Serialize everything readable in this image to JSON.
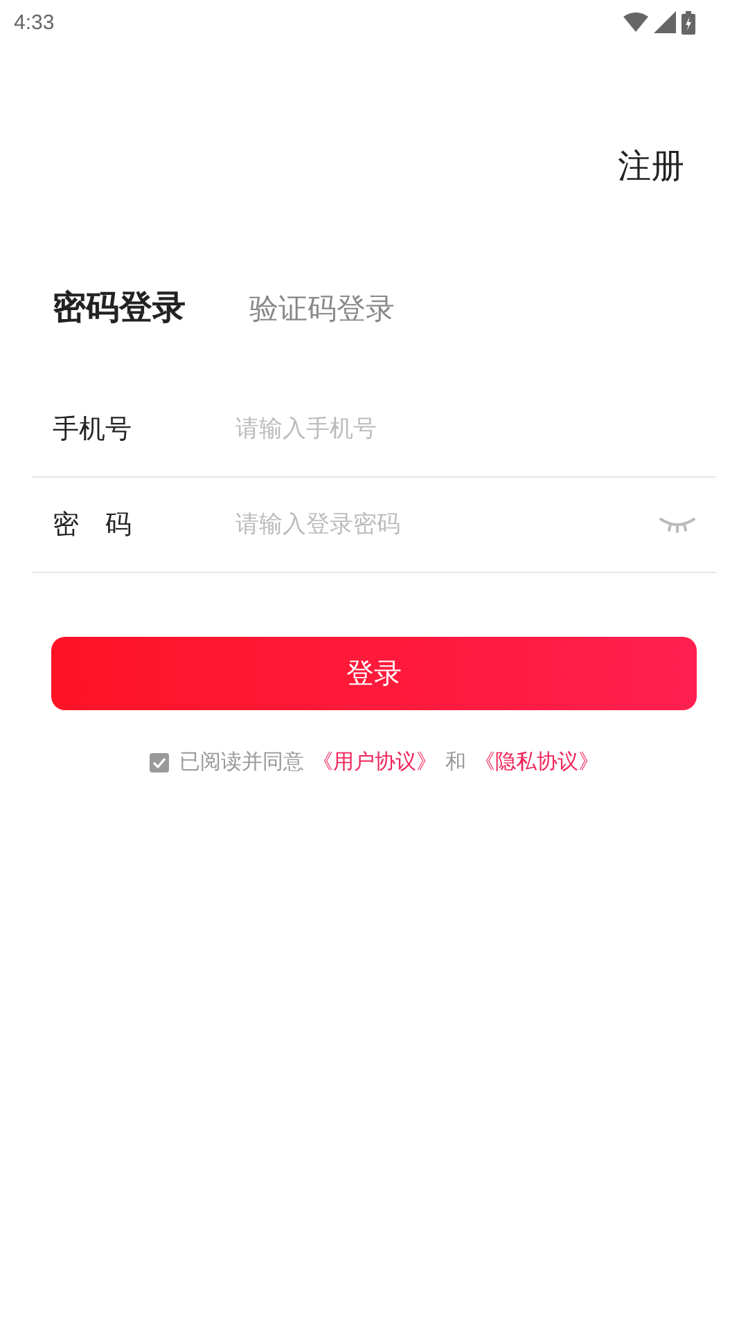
{
  "status_bar": {
    "time": "4:33"
  },
  "register_link": "注册",
  "tabs": [
    {
      "label": "密码登录",
      "selected": true
    },
    {
      "label": "验证码登录",
      "selected": false
    }
  ],
  "fields": [
    {
      "label": "手机号",
      "placeholder": "请输入手机号",
      "kind": "text"
    },
    {
      "label": "密　码",
      "placeholder": "请输入登录密码",
      "kind": "password"
    }
  ],
  "login_button": "登录",
  "agreement": {
    "checked": true,
    "prefix": "已阅读并同意",
    "user_agreement": "《用户协议》",
    "joiner": "和",
    "privacy_policy": "《隐私协议》"
  }
}
